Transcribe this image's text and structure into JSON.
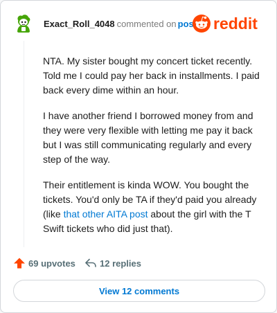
{
  "header": {
    "username": "Exact_Roll_4048",
    "commented_text": "commented on",
    "post_link": "post",
    "logo_text": "reddit",
    "avatar_icon": "snoo-avatar-icon",
    "brand_color": "#ff4500"
  },
  "comment": {
    "paragraphs": [
      "NTA. My sister bought my concert ticket recently. Told me I could pay her back in installments. I paid back every dime within an hour.",
      "I have another friend I borrowed money from and they were very flexible with letting me pay it back but I was still communicating regularly and every step of the way."
    ],
    "p3": {
      "before": "Their entitlement is kinda WOW. You bought the tickets. You'd only be TA if they'd paid you already (like ",
      "link": "that other AITA post",
      "after": " about the girl with the T Swift tickets who did just that)."
    }
  },
  "actions": {
    "upvotes": "69 upvotes",
    "replies": "12 replies",
    "upvote_icon": "upvote-arrow-icon",
    "reply_icon": "reply-arrow-icon",
    "upvote_color": "#ff4500"
  },
  "view_button": {
    "label": "View 12 comments"
  }
}
